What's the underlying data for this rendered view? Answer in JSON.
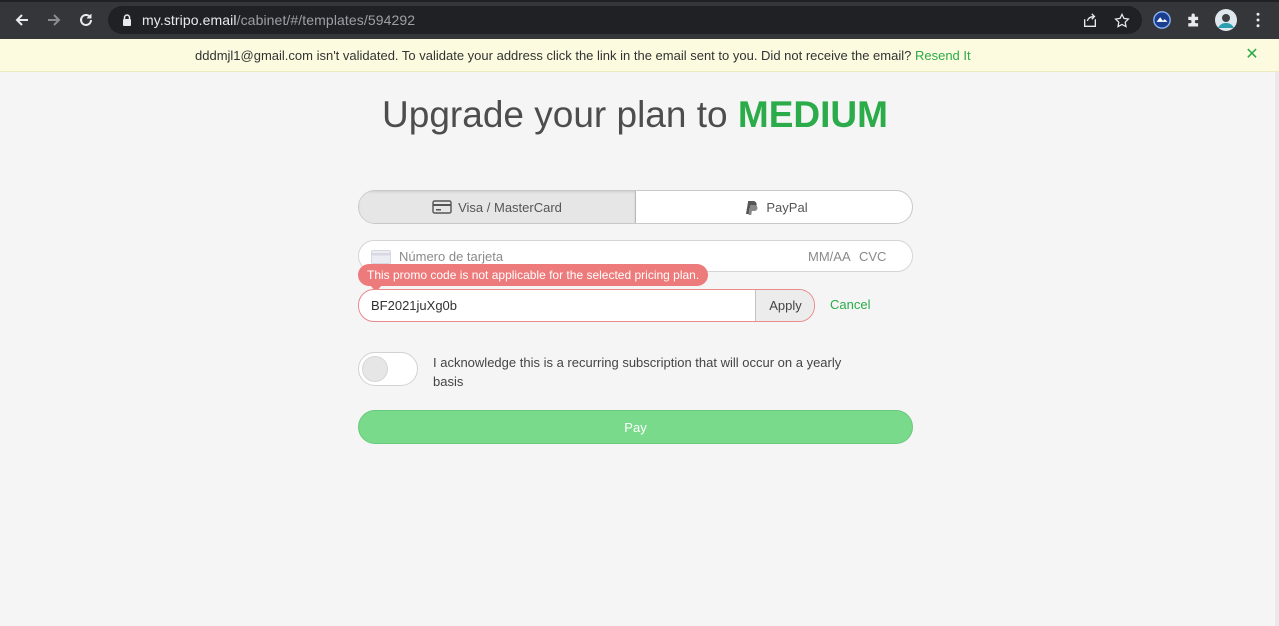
{
  "browser": {
    "url_host": "my.stripo.email",
    "url_path": "/cabinet/#/templates/594292",
    "icons": [
      "back-icon",
      "forward-icon",
      "reload-icon",
      "lock-icon",
      "share-icon",
      "star-icon",
      "extension-icon",
      "puzzle-icon",
      "profile-avatar",
      "menu-icon"
    ]
  },
  "notice": {
    "message": "dddmjl1@gmail.com isn't validated. To validate your address click the link in the email sent to you. Did not receive the email? ",
    "resend_label": "Resend It",
    "close_symbol": "✕"
  },
  "page": {
    "title_prefix": "Upgrade your plan to ",
    "title_plan": "MEDIUM"
  },
  "payment": {
    "tabs": [
      {
        "label": "Visa / MasterCard",
        "icon": "credit-card-icon",
        "active": true
      },
      {
        "label": "PayPal",
        "icon": "paypal-icon",
        "active": false
      }
    ],
    "card_number_placeholder": "Número de tarjeta",
    "expiry_placeholder": "MM/AA",
    "cvc_placeholder": "CVC"
  },
  "promo": {
    "error": "This promo code is not applicable for the selected pricing plan.",
    "value": "BF2021juXg0b",
    "apply_label": "Apply",
    "cancel_label": "Cancel"
  },
  "subscription": {
    "toggle_on": false,
    "acknowledge_text": "I acknowledge this is a recurring subscription that will occur on a yearly basis"
  },
  "pay_label": "Pay",
  "colors": {
    "accent": "#2bab49",
    "error": "#ee7b7b",
    "pay_button": "#79da8c",
    "notice_bg": "#fdfbdf"
  }
}
